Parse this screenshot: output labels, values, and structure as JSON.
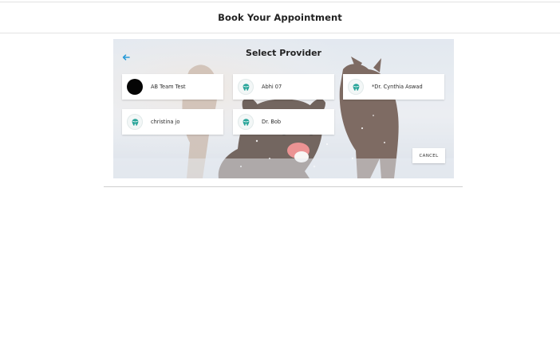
{
  "header": {
    "title": "Book Your Appointment"
  },
  "modal": {
    "title": "Select Provider",
    "cancel_label": "CANCEL",
    "providers": [
      {
        "name": "AB Team Test",
        "avatar": "black-circle"
      },
      {
        "name": "Abhi 07",
        "avatar": "tooth-logo-icon"
      },
      {
        "name": "*Dr. Cynthia Aswad",
        "avatar": "tooth-logo-icon"
      },
      {
        "name": "christina jo",
        "avatar": "tooth-logo-icon"
      },
      {
        "name": "Dr. Bob",
        "avatar": "tooth-logo-icon"
      }
    ]
  },
  "colors": {
    "accent": "#2a9bd8",
    "logo": "#2aa59a",
    "header_text": "#222222"
  }
}
